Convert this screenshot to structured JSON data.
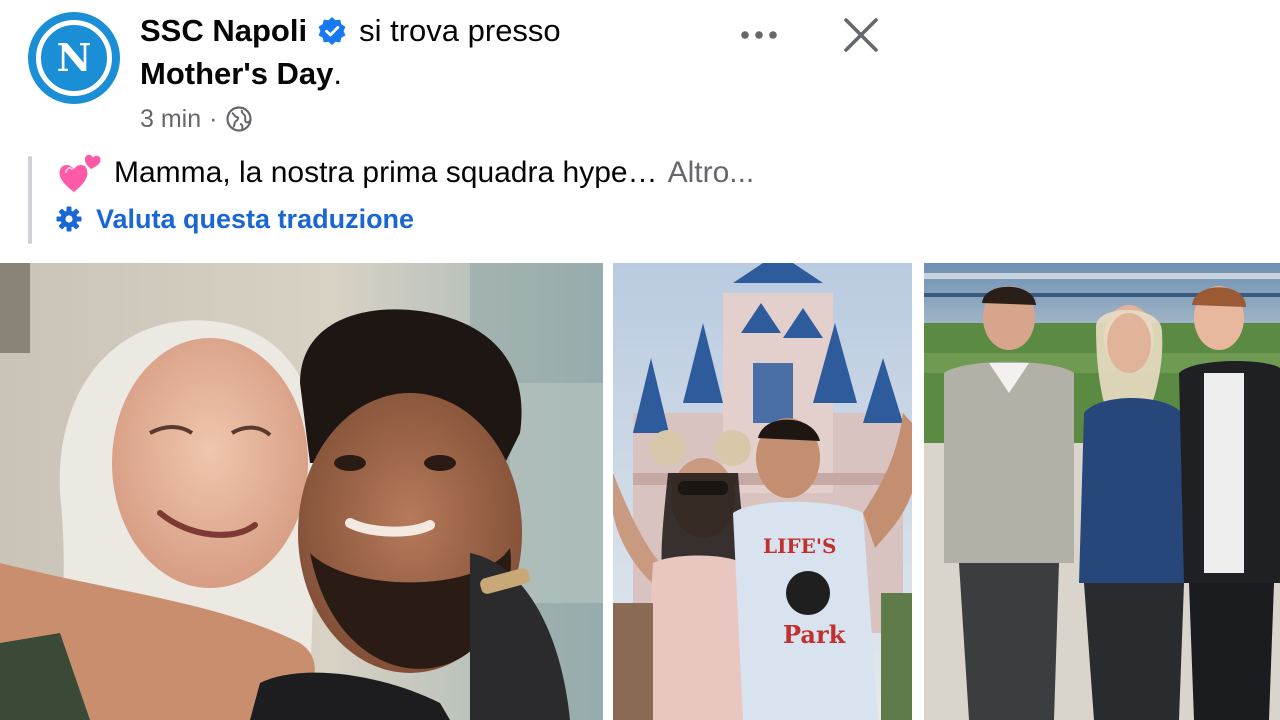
{
  "post": {
    "page_name": "SSC Napoli",
    "title_suffix": "si trova presso",
    "place": "Mother's Day",
    "place_end": ".",
    "time": "3 min",
    "meta_sep": "·",
    "caption": "Mamma, la nostra prima squadra hype…",
    "see_more": "Altro...",
    "translate": "Valuta questa traduzione",
    "avatar_letter": "N"
  },
  "icons": {
    "avatar": "napoli-logo",
    "verified": "verified-badge-icon",
    "globe": "globe-icon",
    "more": "more-options-icon",
    "close": "close-icon",
    "hearts": "two-hearts-emoji",
    "gear": "gear-icon"
  },
  "colors": {
    "text": "#050505",
    "secondary": "#65676b",
    "link": "#1a66d2",
    "verified": "#1877f2",
    "napoli_blue": "#1a8fd6"
  },
  "photos": [
    {
      "description_name": "photo-mother-son-embrace"
    },
    {
      "description_name": "photo-castle-mother-son"
    },
    {
      "description_name": "photo-stadium-family"
    }
  ]
}
